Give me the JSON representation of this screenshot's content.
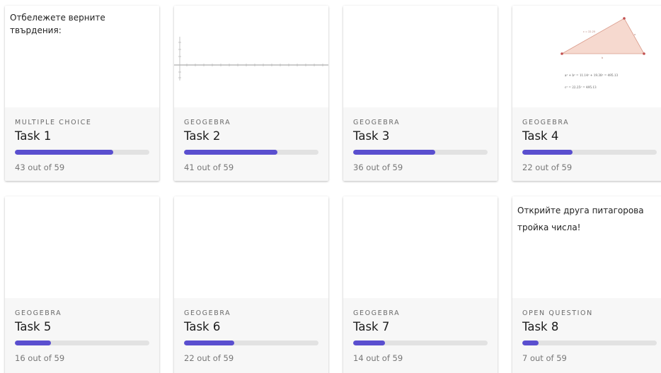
{
  "accent_color": "#5a4fcf",
  "cards": [
    {
      "type": "MULTIPLE CHOICE",
      "title": "Task 1",
      "count_text": "43 out of 59",
      "progress": 0.729,
      "preview_text": "Отбележете верните твърдения:",
      "preview_kind": "text"
    },
    {
      "type": "GEOGEBRA",
      "title": "Task 2",
      "count_text": "41 out of 59",
      "progress": 0.695,
      "preview_text": "",
      "preview_kind": "axes-graph"
    },
    {
      "type": "GEOGEBRA",
      "title": "Task 3",
      "count_text": "36 out of 59",
      "progress": 0.61,
      "preview_text": "",
      "preview_kind": "blank"
    },
    {
      "type": "GEOGEBRA",
      "title": "Task 4",
      "count_text": "22 out of 59",
      "progress": 0.373,
      "preview_text": "",
      "preview_kind": "triangle-figure",
      "preview_formulas": [
        "a² + b² = 11.14² + 19.38² = 495.13",
        "c² = 22.25² = 495.13"
      ]
    },
    {
      "type": "GEOGEBRA",
      "title": "Task 5",
      "count_text": "16 out of 59",
      "progress": 0.271,
      "preview_text": "",
      "preview_kind": "blank"
    },
    {
      "type": "GEOGEBRA",
      "title": "Task 6",
      "count_text": "22 out of 59",
      "progress": 0.373,
      "preview_text": "",
      "preview_kind": "blank"
    },
    {
      "type": "GEOGEBRA",
      "title": "Task 7",
      "count_text": "14 out of 59",
      "progress": 0.237,
      "preview_text": "",
      "preview_kind": "blank"
    },
    {
      "type": "OPEN QUESTION",
      "title": "Task 8",
      "count_text": "7 out of 59",
      "progress": 0.119,
      "preview_text": "Открийте друга питагорова тройка числа!",
      "preview_kind": "text"
    }
  ]
}
